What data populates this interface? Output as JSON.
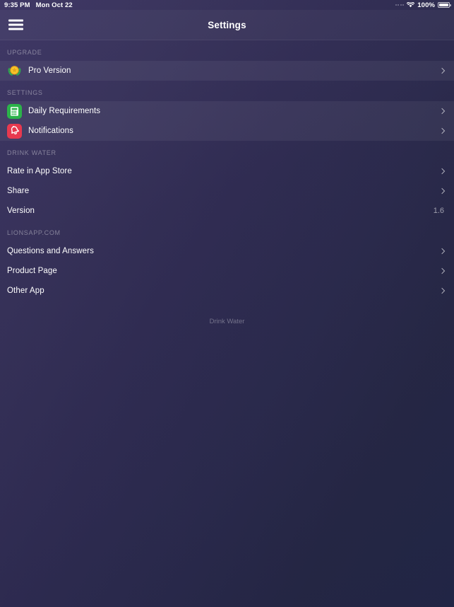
{
  "statusbar": {
    "time": "9:35 PM",
    "date": "Mon Oct 22",
    "battery_percent": "100%",
    "wifi_icon": "wifi-icon",
    "battery_icon": "battery-full-icon"
  },
  "navbar": {
    "title": "Settings",
    "menu_icon": "hamburger-menu-icon"
  },
  "sections": [
    {
      "header": "UPGRADE",
      "highlighted": true,
      "rows": [
        {
          "label": "Pro Version",
          "icon": "medal-laurel-icon",
          "icon_bg": "#4b4470",
          "accessory": "chevron"
        }
      ]
    },
    {
      "header": "SETTINGS",
      "highlighted": true,
      "rows": [
        {
          "label": "Daily Requirements",
          "icon": "calculator-icon",
          "icon_bg": "#2cb34a",
          "accessory": "chevron"
        },
        {
          "label": "Notifications",
          "icon": "bell-icon",
          "icon_bg": "#e8394f",
          "accessory": "chevron"
        }
      ]
    },
    {
      "header": "DRINK WATER",
      "highlighted": false,
      "rows": [
        {
          "label": "Rate in App Store",
          "accessory": "chevron"
        },
        {
          "label": "Share",
          "accessory": "chevron"
        },
        {
          "label": "Version",
          "value": "1.6",
          "accessory": "none"
        }
      ]
    },
    {
      "header": "LIONSAPP.COM",
      "highlighted": false,
      "rows": [
        {
          "label": "Questions and Answers",
          "accessory": "chevron"
        },
        {
          "label": "Product Page",
          "accessory": "chevron"
        },
        {
          "label": "Other App",
          "accessory": "chevron"
        }
      ]
    }
  ],
  "footer": {
    "text": "Drink Water"
  },
  "colors": {
    "bg_top_left": "#3a3360",
    "bg_bottom_right": "#232747",
    "row_highlight": "rgba(255,255,255,0.055)",
    "green": "#2cb34a",
    "red": "#e8394f",
    "gold": "#f5c11e"
  }
}
